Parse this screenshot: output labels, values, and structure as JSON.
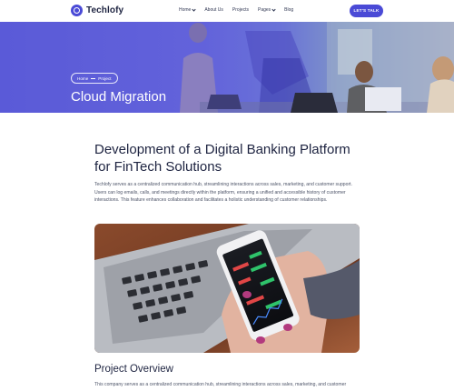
{
  "header": {
    "logo_text": "Techlofy",
    "nav": [
      {
        "label": "Home",
        "has_dropdown": true
      },
      {
        "label": "About Us",
        "has_dropdown": false
      },
      {
        "label": "Projects",
        "has_dropdown": false
      },
      {
        "label": "Pages",
        "has_dropdown": true
      },
      {
        "label": "Blog",
        "has_dropdown": false
      }
    ],
    "cta_label": "LET'S TALK"
  },
  "hero": {
    "breadcrumb": [
      "Home",
      "Project"
    ],
    "title": "Cloud Migration"
  },
  "article": {
    "title": "Development of a Digital Banking Platform for FinTech Solutions",
    "paragraph": "Techlofy serves as a centralized communication hub, streamlining interactions across sales, marketing, and customer support. Users can log emails, calls, and meetings directly within the platform, ensuring a unified and accessible history of customer interactions. This feature enhances collaboration and facilitates a holistic understanding of customer relationships.",
    "section_title": "Project Overview",
    "section_paragraph": "This company serves as a centralized communication hub, streamlining interactions across sales, marketing, and customer"
  },
  "colors": {
    "accent": "#4a4ad6",
    "heading": "#1d2340",
    "body_text": "#4d5468"
  }
}
